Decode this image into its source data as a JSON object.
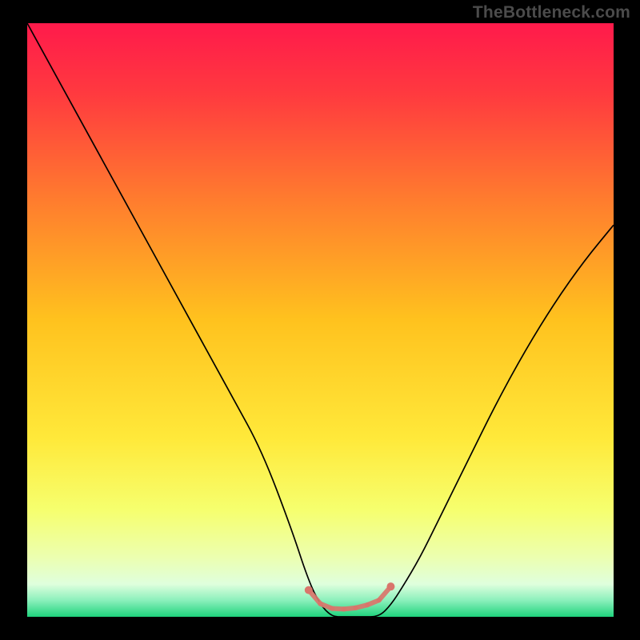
{
  "watermark": "TheBottleneck.com",
  "chart_data": {
    "type": "line",
    "title": "",
    "xlabel": "",
    "ylabel": "",
    "x_range": [
      0,
      100
    ],
    "y_range": [
      0,
      100
    ],
    "background_gradient": {
      "stops": [
        {
          "offset": 0.0,
          "color": "#ff1a4b"
        },
        {
          "offset": 0.12,
          "color": "#ff3a3f"
        },
        {
          "offset": 0.3,
          "color": "#ff7d2e"
        },
        {
          "offset": 0.5,
          "color": "#ffc21e"
        },
        {
          "offset": 0.7,
          "color": "#ffe93a"
        },
        {
          "offset": 0.82,
          "color": "#f6ff6e"
        },
        {
          "offset": 0.9,
          "color": "#ecffb0"
        },
        {
          "offset": 0.945,
          "color": "#dfffdd"
        },
        {
          "offset": 0.972,
          "color": "#8cf0bc"
        },
        {
          "offset": 1.0,
          "color": "#1fd37c"
        }
      ]
    },
    "series": [
      {
        "name": "bottleneck-curve",
        "color": "#000000",
        "width": 1.7,
        "x": [
          0,
          5,
          10,
          15,
          20,
          25,
          30,
          35,
          40,
          45,
          48,
          50,
          52,
          54,
          57,
          60,
          62,
          64,
          67,
          70,
          75,
          80,
          85,
          90,
          95,
          100
        ],
        "y": [
          100,
          91,
          82,
          73,
          64,
          55,
          46,
          37,
          28,
          15,
          6,
          2,
          0,
          0,
          0,
          0,
          2,
          5,
          10,
          16,
          26,
          36,
          45,
          53,
          60,
          66
        ]
      }
    ],
    "markers": {
      "name": "valley-highlight",
      "color": "#d9756b",
      "endpoint_radius": 5,
      "mid_radius": 3.1,
      "points": [
        {
          "x": 48,
          "y": 4.5
        },
        {
          "x": 50,
          "y": 2.2
        },
        {
          "x": 52,
          "y": 1.4
        },
        {
          "x": 54,
          "y": 1.3
        },
        {
          "x": 56,
          "y": 1.5
        },
        {
          "x": 58,
          "y": 2.0
        },
        {
          "x": 60,
          "y": 2.8
        },
        {
          "x": 62,
          "y": 5.1
        }
      ]
    }
  }
}
